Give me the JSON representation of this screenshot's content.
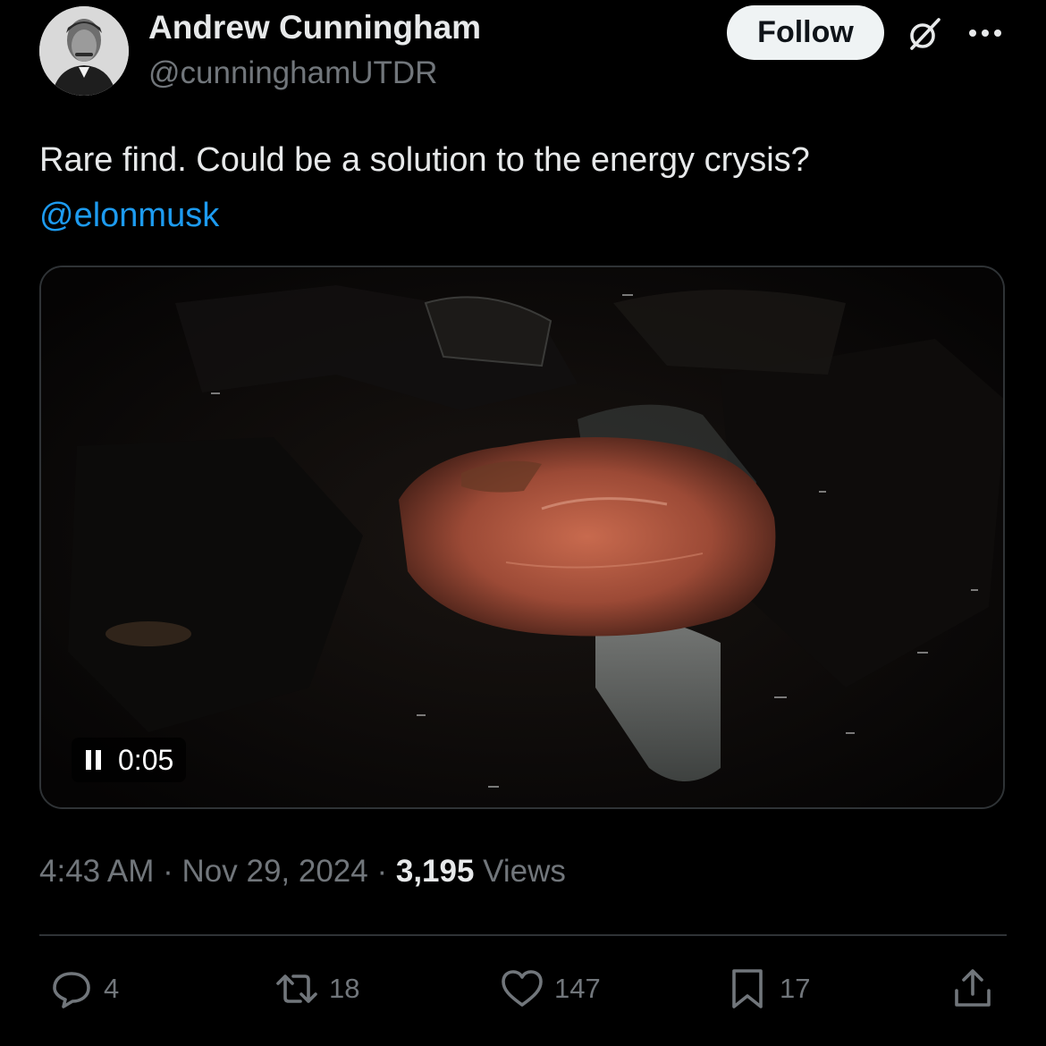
{
  "author": {
    "name": "Andrew Cunningham",
    "handle": "@cunninghamUTDR"
  },
  "header": {
    "follow_label": "Follow",
    "grok_icon": "grok-icon",
    "more_icon": "more-icon"
  },
  "tweet": {
    "text": "Rare find. Could be a solution to the energy crysis?",
    "mention": "@elonmusk"
  },
  "video": {
    "state_icon": "pause-icon",
    "time": "0:05"
  },
  "meta": {
    "time": "4:43 AM",
    "sep1": " · ",
    "date": "Nov 29, 2024",
    "sep2": " · ",
    "views_count": "3,195",
    "views_label": " Views"
  },
  "actions": {
    "replies": "4",
    "reposts": "18",
    "likes": "147",
    "bookmarks": "17"
  },
  "colors": {
    "background": "#000000",
    "text": "#e7e9ea",
    "muted": "#71767b",
    "link": "#1d9bf0",
    "border": "#2f3336"
  }
}
